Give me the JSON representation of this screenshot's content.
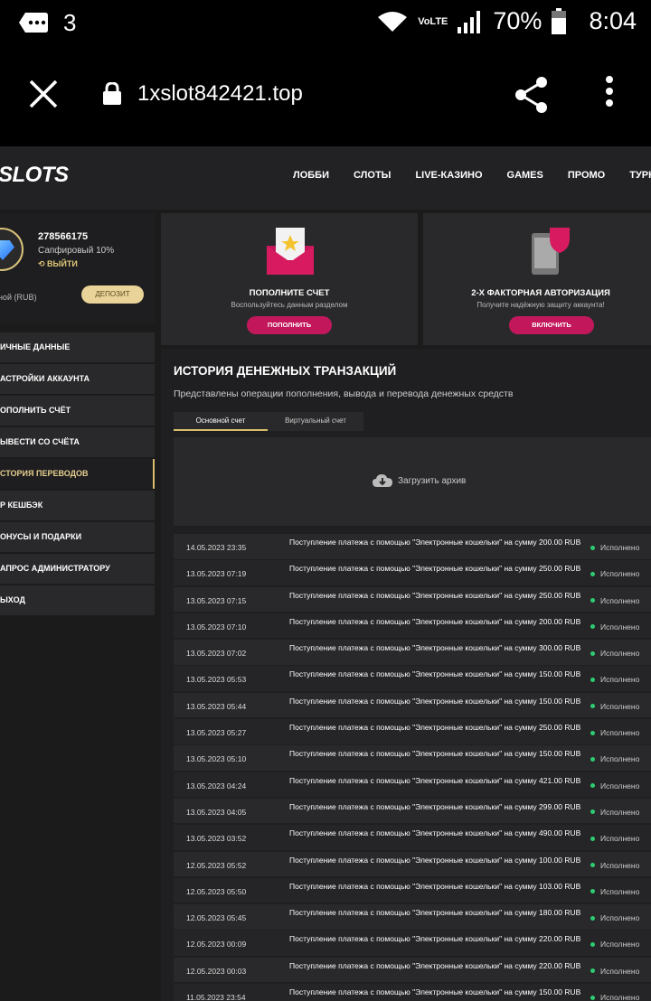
{
  "status_bar": {
    "notification_count": "3",
    "network": "VoLTE",
    "battery": "70%",
    "time": "8:04"
  },
  "browser": {
    "url": "1xslot842421.top"
  },
  "site": {
    "logo": "SLOTS",
    "nav": [
      "ЛОББИ",
      "СЛОТЫ",
      "LIVE-КАЗИНО",
      "GAMES",
      "ПРОМО",
      "ТУРНИРЫ"
    ]
  },
  "profile": {
    "account_id": "278566175",
    "level": "Сапфировый 10%",
    "exit": "ВЫЙТИ",
    "currency": "ной (RUB)",
    "deposit": "ДЕПОЗИТ"
  },
  "menu": [
    "ИЧНЫЕ ДАННЫЕ",
    "АСТРОЙКИ АККАУНТА",
    "ОПОЛНИТЬ СЧЁТ",
    "ЫВЕСТИ СО СЧЁТА",
    "СТОРИЯ ПЕРЕВОДОВ",
    "Р КЕШБЭК",
    "ОНУСЫ И ПОДАРКИ",
    "АПРОС АДМИНИСТРАТОРУ",
    "ЫХОД"
  ],
  "cards": [
    {
      "title": "ПОПОЛНИТЕ СЧЕТ",
      "sub": "Воспользуйтесь данным разделом",
      "button": "ПОПОЛНИТЬ",
      "icon": "envelope-star-icon"
    },
    {
      "title": "2-Х ФАКТОРНАЯ АВТОРИЗАЦИЯ",
      "sub": "Получите надёжную защиту аккаунта!",
      "button": "ВКЛЮЧИТЬ",
      "icon": "phone-shield-icon"
    }
  ],
  "main": {
    "title": "ИСТОРИЯ ДЕНЕЖНЫХ ТРАНЗАКЦИЙ",
    "subtitle": "Представлены операции пополнения, вывода и перевода денежных средств",
    "tabs": [
      "Основной счет",
      "Виртуальный счет"
    ],
    "archive": "Загрузить архив"
  },
  "transactions": [
    {
      "date": "14.05.2023 23:35",
      "desc": "Поступление платежа с помощью \"Электронные кошельки\" на сумму 200.00 RUB",
      "status": "Исполнено"
    },
    {
      "date": "13.05.2023 07:19",
      "desc": "Поступление платежа с помощью \"Электронные кошельки\" на сумму 250.00 RUB",
      "status": "Исполнено"
    },
    {
      "date": "13.05.2023 07:15",
      "desc": "Поступление платежа с помощью \"Электронные кошельки\" на сумму 250.00 RUB",
      "status": "Исполнено"
    },
    {
      "date": "13.05.2023 07:10",
      "desc": "Поступление платежа с помощью \"Электронные кошельки\" на сумму 200.00 RUB",
      "status": "Исполнено"
    },
    {
      "date": "13.05.2023 07:02",
      "desc": "Поступление платежа с помощью \"Электронные кошельки\" на сумму 300.00 RUB",
      "status": "Исполнено"
    },
    {
      "date": "13.05.2023 05:53",
      "desc": "Поступление платежа с помощью \"Электронные кошельки\" на сумму 150.00 RUB",
      "status": "Исполнено"
    },
    {
      "date": "13.05.2023 05:44",
      "desc": "Поступление платежа с помощью \"Электронные кошельки\" на сумму 150.00 RUB",
      "status": "Исполнено"
    },
    {
      "date": "13.05.2023 05:27",
      "desc": "Поступление платежа с помощью \"Электронные кошельки\" на сумму 250.00 RUB",
      "status": "Исполнено"
    },
    {
      "date": "13.05.2023 05:10",
      "desc": "Поступление платежа с помощью \"Электронные кошельки\" на сумму 150.00 RUB",
      "status": "Исполнено"
    },
    {
      "date": "13.05.2023 04:24",
      "desc": "Поступление платежа с помощью \"Электронные кошельки\" на сумму 421.00 RUB",
      "status": "Исполнено"
    },
    {
      "date": "13.05.2023 04:05",
      "desc": "Поступление платежа с помощью \"Электронные кошельки\" на сумму 299.00 RUB",
      "status": "Исполнено"
    },
    {
      "date": "13.05.2023 03:52",
      "desc": "Поступление платежа с помощью \"Электронные кошельки\" на сумму 490.00 RUB",
      "status": "Исполнено"
    },
    {
      "date": "12.05.2023 05:52",
      "desc": "Поступление платежа с помощью \"Электронные кошельки\" на сумму 100.00 RUB",
      "status": "Исполнено"
    },
    {
      "date": "12.05.2023 05:50",
      "desc": "Поступление платежа с помощью \"Электронные кошельки\" на сумму 103.00 RUB",
      "status": "Исполнено"
    },
    {
      "date": "12.05.2023 05:45",
      "desc": "Поступление платежа с помощью \"Электронные кошельки\" на сумму 180.00 RUB",
      "status": "Исполнено"
    },
    {
      "date": "12.05.2023 00:09",
      "desc": "Поступление платежа с помощью \"Электронные кошельки\" на сумму 220.00 RUB",
      "status": "Исполнено"
    },
    {
      "date": "12.05.2023 00:03",
      "desc": "Поступление платежа с помощью \"Электронные кошельки\" на сумму 220.00 RUB",
      "status": "Исполнено"
    },
    {
      "date": "11.05.2023 23:54",
      "desc": "Поступление платежа с помощью \"Электронные кошельки\" на сумму 150.00 RUB",
      "status": "Исполнено"
    }
  ]
}
